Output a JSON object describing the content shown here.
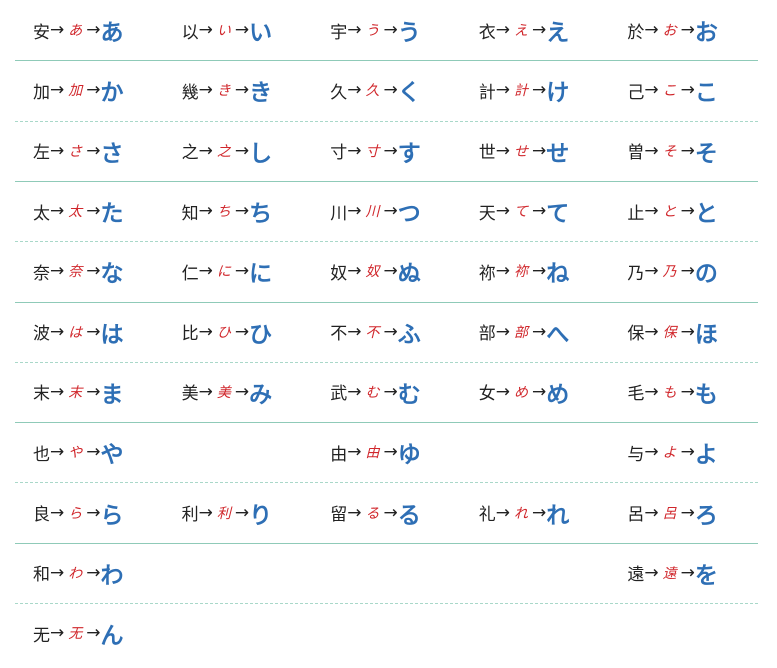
{
  "colors": {
    "kanji": "#222222",
    "cursive": "#d0262b",
    "kana": "#2e6fb5",
    "solid_rule": "#8fcab8",
    "dashed_rule": "#a9d8c9"
  },
  "arrow": "→",
  "rows": [
    {
      "rule_below": "solid",
      "cells": [
        {
          "kanji": "安",
          "cursive": "あ",
          "kana": "あ"
        },
        {
          "kanji": "以",
          "cursive": "い",
          "kana": "い"
        },
        {
          "kanji": "宇",
          "cursive": "う",
          "kana": "う"
        },
        {
          "kanji": "衣",
          "cursive": "え",
          "kana": "え"
        },
        {
          "kanji": "於",
          "cursive": "お",
          "kana": "お"
        }
      ]
    },
    {
      "rule_below": "dashed",
      "cells": [
        {
          "kanji": "加",
          "cursive": "加",
          "kana": "か"
        },
        {
          "kanji": "幾",
          "cursive": "き",
          "kana": "き"
        },
        {
          "kanji": "久",
          "cursive": "久",
          "kana": "く"
        },
        {
          "kanji": "計",
          "cursive": "計",
          "kana": "け"
        },
        {
          "kanji": "己",
          "cursive": "こ",
          "kana": "こ"
        }
      ]
    },
    {
      "rule_below": "solid",
      "cells": [
        {
          "kanji": "左",
          "cursive": "さ",
          "kana": "さ"
        },
        {
          "kanji": "之",
          "cursive": "之",
          "kana": "し"
        },
        {
          "kanji": "寸",
          "cursive": "寸",
          "kana": "す"
        },
        {
          "kanji": "世",
          "cursive": "せ",
          "kana": "せ"
        },
        {
          "kanji": "曽",
          "cursive": "そ",
          "kana": "そ"
        }
      ]
    },
    {
      "rule_below": "dashed",
      "cells": [
        {
          "kanji": "太",
          "cursive": "太",
          "kana": "た"
        },
        {
          "kanji": "知",
          "cursive": "ち",
          "kana": "ち"
        },
        {
          "kanji": "川",
          "cursive": "川",
          "kana": "つ"
        },
        {
          "kanji": "天",
          "cursive": "て",
          "kana": "て"
        },
        {
          "kanji": "止",
          "cursive": "と",
          "kana": "と"
        }
      ]
    },
    {
      "rule_below": "solid",
      "cells": [
        {
          "kanji": "奈",
          "cursive": "奈",
          "kana": "な"
        },
        {
          "kanji": "仁",
          "cursive": "に",
          "kana": "に"
        },
        {
          "kanji": "奴",
          "cursive": "奴",
          "kana": "ぬ"
        },
        {
          "kanji": "祢",
          "cursive": "祢",
          "kana": "ね"
        },
        {
          "kanji": "乃",
          "cursive": "乃",
          "kana": "の"
        }
      ]
    },
    {
      "rule_below": "dashed",
      "cells": [
        {
          "kanji": "波",
          "cursive": "は",
          "kana": "は"
        },
        {
          "kanji": "比",
          "cursive": "ひ",
          "kana": "ひ"
        },
        {
          "kanji": "不",
          "cursive": "不",
          "kana": "ふ"
        },
        {
          "kanji": "部",
          "cursive": "部",
          "kana": "へ"
        },
        {
          "kanji": "保",
          "cursive": "保",
          "kana": "ほ"
        }
      ]
    },
    {
      "rule_below": "solid",
      "cells": [
        {
          "kanji": "末",
          "cursive": "末",
          "kana": "ま"
        },
        {
          "kanji": "美",
          "cursive": "美",
          "kana": "み"
        },
        {
          "kanji": "武",
          "cursive": "む",
          "kana": "む"
        },
        {
          "kanji": "女",
          "cursive": "め",
          "kana": "め"
        },
        {
          "kanji": "毛",
          "cursive": "も",
          "kana": "も"
        }
      ]
    },
    {
      "rule_below": "dashed",
      "cells": [
        {
          "kanji": "也",
          "cursive": "や",
          "kana": "や"
        },
        null,
        {
          "kanji": "由",
          "cursive": "由",
          "kana": "ゆ"
        },
        null,
        {
          "kanji": "与",
          "cursive": "よ",
          "kana": "よ"
        }
      ]
    },
    {
      "rule_below": "solid",
      "cells": [
        {
          "kanji": "良",
          "cursive": "ら",
          "kana": "ら"
        },
        {
          "kanji": "利",
          "cursive": "利",
          "kana": "り"
        },
        {
          "kanji": "留",
          "cursive": "る",
          "kana": "る"
        },
        {
          "kanji": "礼",
          "cursive": "れ",
          "kana": "れ"
        },
        {
          "kanji": "呂",
          "cursive": "呂",
          "kana": "ろ"
        }
      ]
    },
    {
      "rule_below": "dashed",
      "cells": [
        {
          "kanji": "和",
          "cursive": "わ",
          "kana": "わ"
        },
        null,
        null,
        null,
        {
          "kanji": "遠",
          "cursive": "遠",
          "kana": "を"
        }
      ]
    },
    {
      "rule_below": "none",
      "cells": [
        {
          "kanji": "无",
          "cursive": "无",
          "kana": "ん"
        },
        null,
        null,
        null,
        null
      ]
    }
  ]
}
